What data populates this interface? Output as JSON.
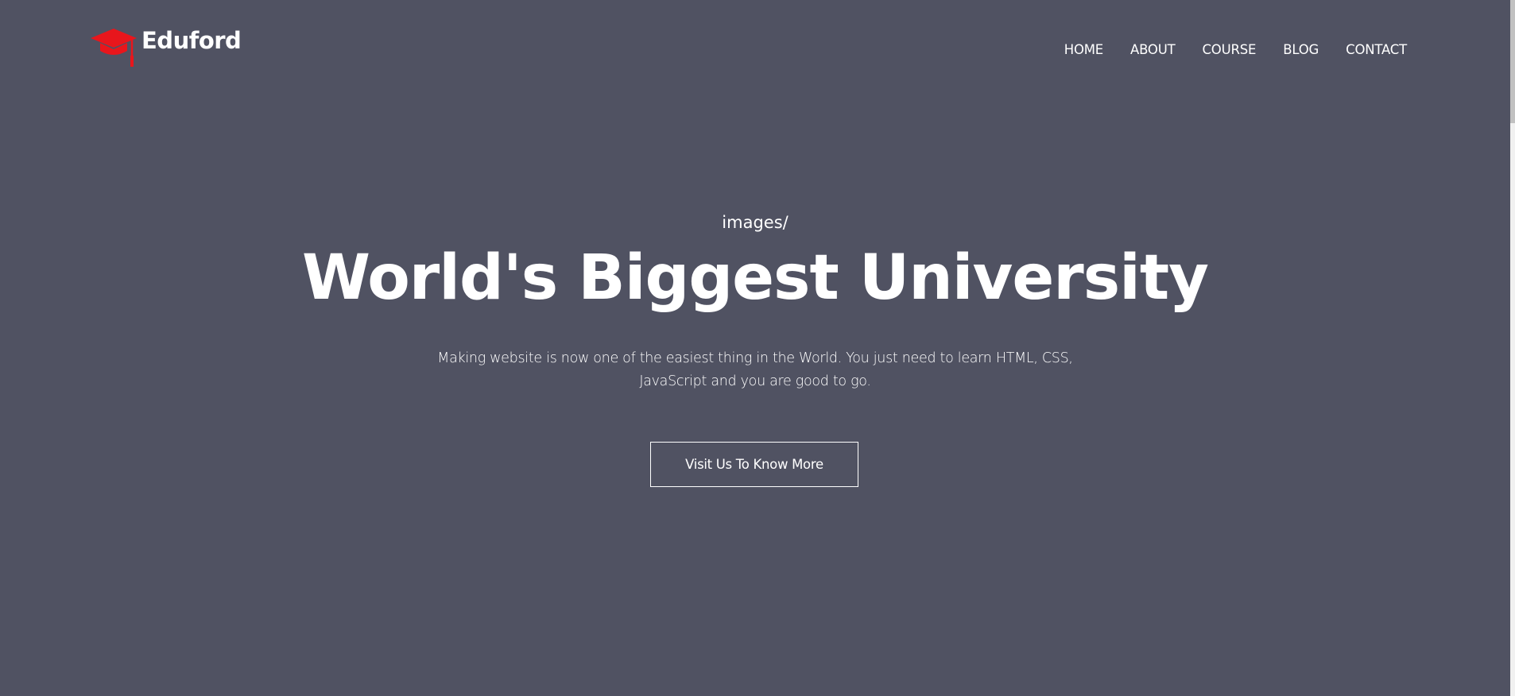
{
  "brand": {
    "name": "Eduford",
    "logo_icon": "graduation-cap-icon",
    "logo_color": "#e8161c"
  },
  "nav": {
    "items": [
      {
        "label": "HOME"
      },
      {
        "label": "ABOUT"
      },
      {
        "label": "COURSE"
      },
      {
        "label": "BLOG"
      },
      {
        "label": "CONTACT"
      }
    ]
  },
  "hero": {
    "kicker": "images/",
    "title": "World's Biggest University",
    "description": "Making website is now one of the easiest thing in the World. You just need to learn HTML, CSS, JavaScript and you are good to go.",
    "button_label": "Visit Us To Know More"
  },
  "colors": {
    "background": "#505262",
    "text": "#ffffff",
    "accent": "#e8161c"
  }
}
